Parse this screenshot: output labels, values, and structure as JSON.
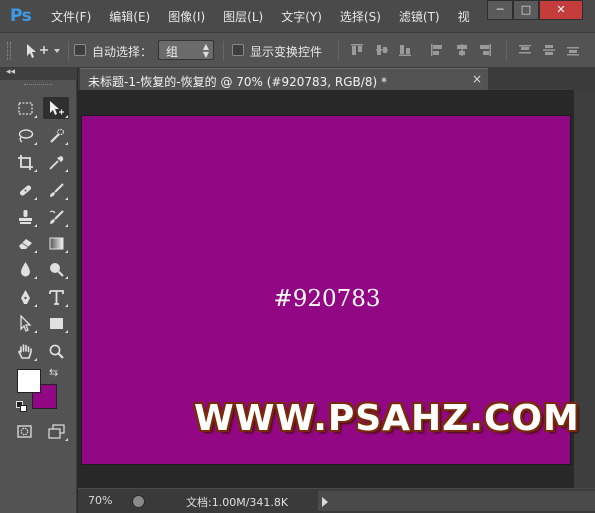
{
  "app": {
    "logo": "Ps"
  },
  "menu": [
    "文件(F)",
    "编辑(E)",
    "图像(I)",
    "图层(L)",
    "文字(Y)",
    "选择(S)",
    "滤镜(T)",
    "视"
  ],
  "window_controls": {
    "minimize": "─",
    "restore": "□",
    "close": "✕"
  },
  "options": {
    "auto_select_label": "自动选择：",
    "auto_select_value": "组",
    "show_transform_label": "显示变换控件"
  },
  "tools_panel": {
    "collapse_glyph": "◂◂",
    "swap_glyph": "⇆"
  },
  "colors": {
    "foreground": "#ffffff",
    "background": "#920783",
    "accent": "#3d9ae8"
  },
  "document": {
    "tab_title": "未标题-1-恢复的-恢复的 @ 70% (#920783, RGB/8) *",
    "tab_close": "×",
    "canvas_color": "#920783",
    "hex_label": "#920783",
    "watermark": "WWW.PSAHZ.COM"
  },
  "status": {
    "zoom": "70%",
    "doc_info": "文档:1.00M/341.8K"
  }
}
